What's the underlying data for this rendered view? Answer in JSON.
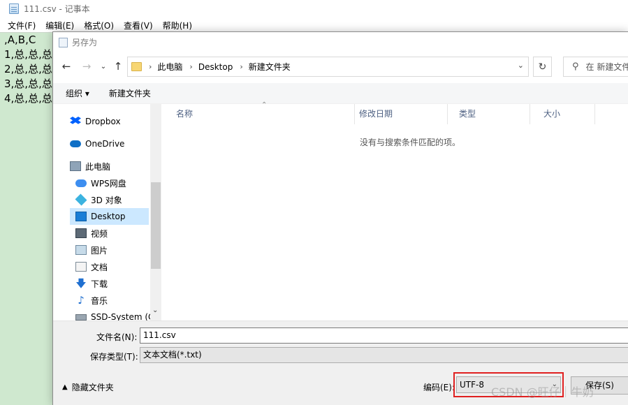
{
  "notepad": {
    "title": "111.csv - 记事本",
    "menu": [
      "文件(F)",
      "编辑(E)",
      "格式(O)",
      "查看(V)",
      "帮助(H)"
    ],
    "lines": [
      ",A,B,C",
      "1,总,总,总",
      "2,总,总,总",
      "3,总,总,总",
      "4,总,总,总"
    ]
  },
  "dialog": {
    "title": "另存为",
    "breadcrumb": [
      "此电脑",
      "Desktop",
      "新建文件夹"
    ],
    "search_placeholder": "在 新建文件",
    "toolbar": {
      "organize": "组织 ▾",
      "new_folder": "新建文件夹"
    },
    "nav_items": [
      {
        "label": "Dropbox",
        "icon": "dropbox-icon"
      },
      {
        "label": "OneDrive",
        "icon": "onedrive-icon"
      },
      {
        "label": "此电脑",
        "icon": "computer-icon"
      },
      {
        "label": "WPS网盘",
        "icon": "wps-cloud-icon"
      },
      {
        "label": "3D 对象",
        "icon": "3d-objects-icon"
      },
      {
        "label": "Desktop",
        "icon": "desktop-icon"
      },
      {
        "label": "视频",
        "icon": "videos-icon"
      },
      {
        "label": "图片",
        "icon": "pictures-icon"
      },
      {
        "label": "文档",
        "icon": "documents-icon"
      },
      {
        "label": "下载",
        "icon": "downloads-icon"
      },
      {
        "label": "音乐",
        "icon": "music-icon"
      },
      {
        "label": "SSD-System (C",
        "icon": "drive-icon"
      }
    ],
    "columns": [
      "名称",
      "修改日期",
      "类型",
      "大小"
    ],
    "empty_message": "没有与搜索条件匹配的项。",
    "filename_label": "文件名(N):",
    "filename_value": "111.csv",
    "filetype_label": "保存类型(T):",
    "filetype_value": "文本文档(*.txt)",
    "hide_folders": "隐藏文件夹",
    "encoding_label": "编码(E):",
    "encoding_value": "UTF-8",
    "save_label": "保存(S)"
  },
  "watermark": "CSDN @旺仔｜牛奶",
  "colors": {
    "selected": "#cce8ff",
    "highlight_box": "#e02020",
    "editor_bg": "#cfe8cf"
  }
}
